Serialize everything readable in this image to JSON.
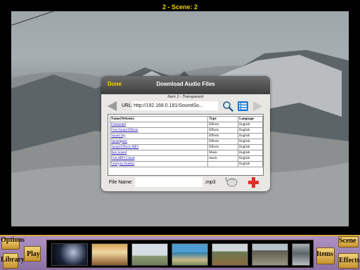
{
  "window": {
    "title": "2 - Scene: 2"
  },
  "popover": {
    "done_label": "Done",
    "title": "Download Audio Files",
    "subtitle": "Item 1 - Transparent",
    "url_label": "URL:",
    "url_value": "http://192.168.0.181/SoundSo...",
    "file_name_label": "File Name:",
    "file_name_value": "",
    "file_extension": ".mp3",
    "table": {
      "headers": [
        "Name(Website)",
        "Type",
        "Language"
      ],
      "rows": [
        [
          "Freesound",
          "Effects",
          "English"
        ],
        [
          "Free Sound Effects",
          "Effects",
          "English"
        ],
        [
          "Sound Jay",
          "Effects",
          "English"
        ],
        [
          "Soundgator",
          "Effects",
          "English"
        ],
        [
          "Sound Effects MP3",
          "Effects",
          "English"
        ],
        [
          "Ben Sound",
          "Music",
          "English"
        ],
        [
          "Free MP3 Cloud",
          "music",
          "English"
        ],
        [
          "Fesliyan Studios",
          "",
          "English"
        ]
      ]
    }
  },
  "toolbar": {
    "options_label": "Options",
    "library_label": "Library",
    "play_label": "Play",
    "items_label": "Items",
    "scene_label": "Scene",
    "effects_label": "Effects"
  },
  "colors": {
    "accent": "#ffd400",
    "link": "#1a0fb0",
    "toolbar": "#9a80b2",
    "add": "#e0302a"
  }
}
